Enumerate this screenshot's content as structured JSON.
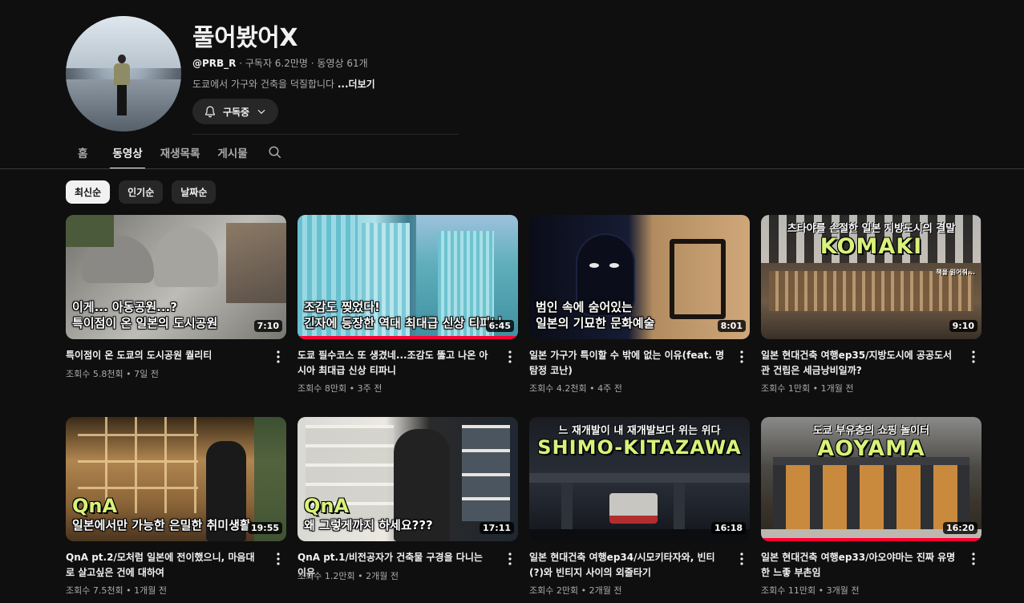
{
  "channel": {
    "name": "풀어봤어X",
    "handle": "@PRB_R",
    "meta_rest": " · 구독자 6.2만명 · 동영상 61개",
    "description": "도쿄에서 가구와 건축을 덕질합니다 ",
    "more_label": "...더보기",
    "subscribe_label": "구독중"
  },
  "tabs": [
    {
      "label": "홈",
      "active": false
    },
    {
      "label": "동영상",
      "active": true
    },
    {
      "label": "재생목록",
      "active": false
    },
    {
      "label": "게시물",
      "active": false
    }
  ],
  "chips": [
    {
      "label": "최신순",
      "active": true
    },
    {
      "label": "인기순",
      "active": false
    },
    {
      "label": "날짜순",
      "active": false
    }
  ],
  "videos": [
    {
      "title": "특이점이 온 도쿄의 도시공원 퀄리티",
      "views": "조회수 5.8천회",
      "age": "7일 전",
      "duration": "7:10",
      "thumb_line1": "이게... 아동공원...?",
      "thumb_line2": "특이점이 온 일본의 도시공원"
    },
    {
      "title": "도쿄 필수코스 또 생겼네...조감도 뚫고 나온 아시아 최대급 신상 티파니",
      "views": "조회수 8만회",
      "age": "3주 전",
      "duration": "6:45",
      "thumb_line1": "조감도 찢었다!",
      "thumb_line2": "긴자에 등장한 역대 최대급 신상 티파니"
    },
    {
      "title": "일본 가구가 특이할 수 밖에 없는 이유(feat. 명탐정 코난)",
      "views": "조회수 4.2천회",
      "age": "4주 전",
      "duration": "8:01",
      "thumb_line1": "범인 속에 숨어있는",
      "thumb_line2": "일본의 기묘한 문화예술"
    },
    {
      "title": "일본 현대건축 여행ep35/지방도시에 공공도서관 건립은 세금낭비일까?",
      "views": "조회수 1만회",
      "age": "1개월 전",
      "duration": "9:10",
      "thumb_caption": "츠타야를 손절한 일본 지방도시의 결말",
      "thumb_word": "KOMAKI",
      "thumb_small": "책을 읽어줘..."
    },
    {
      "title": "QnA pt.2/모처럼 일본에 전이했으니, 마음대로 살고싶은 건에 대하여",
      "views": "조회수 7.5천회",
      "age": "1개월 전",
      "duration": "19:55",
      "thumb_qna": "QnA",
      "thumb_line2": "일본에서만 가능한 은밀한 취미생활"
    },
    {
      "title": "QnA pt.1/비전공자가 건축물 구경을 다니는 이유",
      "views": "조회수 1.2만회",
      "age": "2개월 전",
      "duration": "17:11",
      "thumb_qna": "QnA",
      "thumb_line2": "왜 그렇게까지 하세요???"
    },
    {
      "title": "일본 현대건축 여행ep34/시모키타자와, 빈티(?)와 빈티지 사이의 외줄타기",
      "views": "조회수 2만회",
      "age": "2개월 전",
      "duration": "16:18",
      "thumb_caption": "느 재개발이 내 재개발보다 위는 위다",
      "thumb_word": "SHIMO-KITAZAWA"
    },
    {
      "title": "일본 현대건축 여행ep33/아오야마는 진짜 유명한 느좋 부촌임",
      "views": "조회수 11만회",
      "age": "3개월 전",
      "duration": "16:20",
      "thumb_caption": "도쿄 부유층의 쇼핑 놀이터",
      "thumb_word": "AOYAMA"
    }
  ],
  "colors": {
    "background": "#0f0f0f",
    "progress": "#ff0033",
    "accent_text": "#d8f27a"
  }
}
